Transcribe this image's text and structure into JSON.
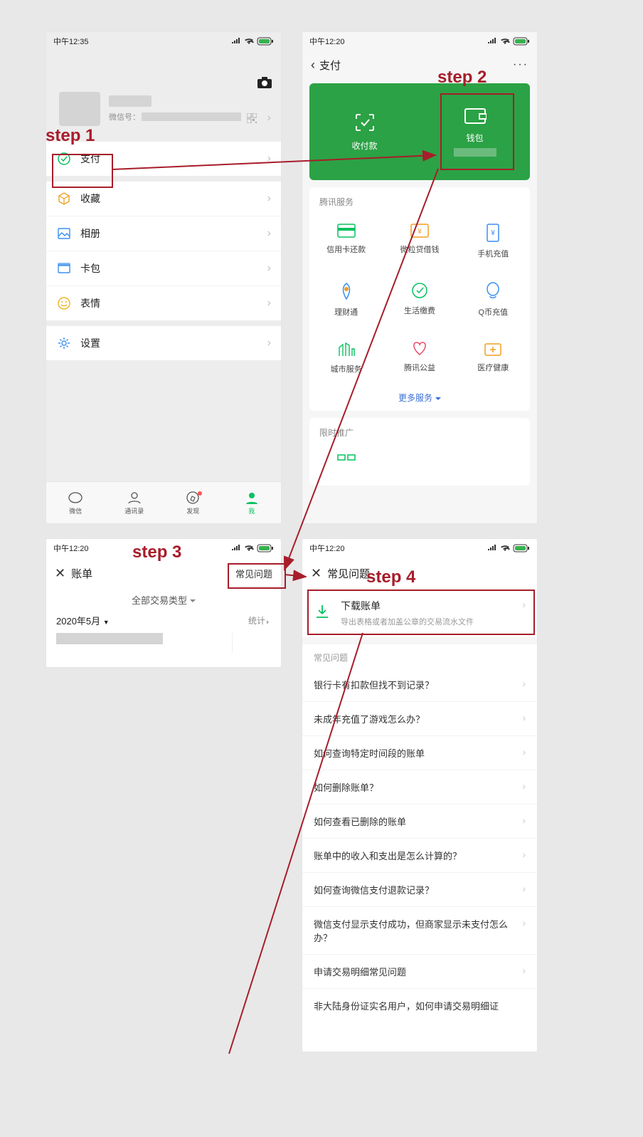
{
  "annotations": {
    "step1": "step 1",
    "step2": "step 2",
    "step3": "step 3",
    "step4": "step 4"
  },
  "statusbar": {
    "time1": "中午12:35",
    "time2": "中午12:20",
    "time3": "中午12:20",
    "time4": "中午12:20"
  },
  "screen1": {
    "wx_label": "微信号：",
    "menu": {
      "pay": "支付",
      "fav": "收藏",
      "album": "相册",
      "card": "卡包",
      "sticker": "表情",
      "settings": "设置"
    },
    "tabs": {
      "wechat": "微信",
      "contacts": "通讯录",
      "discover": "发现",
      "me": "我"
    }
  },
  "screen2": {
    "title": "支付",
    "receive": "收付款",
    "wallet": "钱包",
    "section1": "腾讯服务",
    "services": {
      "credit": "信用卡还款",
      "loan": "微粒贷借钱",
      "recharge": "手机充值",
      "licai": "理财通",
      "life": "生活缴费",
      "qb": "Q币充值",
      "city": "城市服务",
      "gongyi": "腾讯公益",
      "medical": "医疗健康"
    },
    "more": "更多服务",
    "section2": "限时推广"
  },
  "screen3": {
    "title": "账单",
    "faq": "常见问题",
    "filter": "全部交易类型",
    "month": "2020年5月",
    "stat": "统计"
  },
  "screen4": {
    "title": "常见问题",
    "dl_title": "下载账单",
    "dl_sub": "导出表格或者加盖公章的交易流水文件",
    "section": "常见问题",
    "q1": "银行卡有扣款但找不到记录？",
    "q2": "未成年充值了游戏怎么办？",
    "q3": "如何查询特定时间段的账单",
    "q4": "如何删除账单？",
    "q5": "如何查看已删除的账单",
    "q6": "账单中的收入和支出是怎么计算的？",
    "q7": "如何查询微信支付退款记录？",
    "q8": "微信支付显示支付成功，但商家显示未支付怎么办？",
    "q9": "申请交易明细常见问题",
    "q10": "非大陆身份证实名用户，如何申请交易明细证"
  }
}
